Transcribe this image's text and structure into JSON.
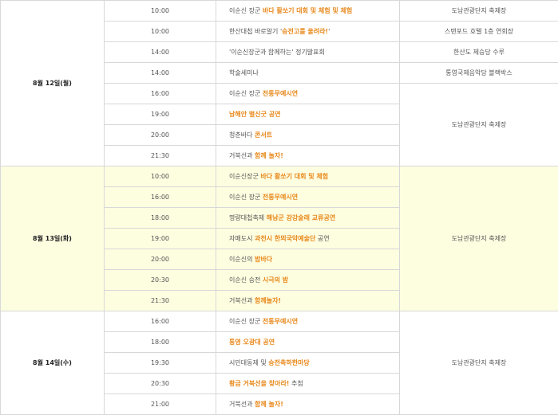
{
  "days": [
    {
      "date": "8월 12일(월)",
      "rows": [
        {
          "time": "10:00",
          "event": [
            {
              "t": "이순신 장군 ",
              "em": false
            },
            {
              "t": "바다 활쏘기 대회 및 체험 및 체험",
              "em": true
            }
          ],
          "venue": "도남관광단지 축제장",
          "span": 1
        },
        {
          "time": "10:00",
          "event": [
            {
              "t": "한산대첩 바로알기 '",
              "em": false
            },
            {
              "t": "승전고를 울려라!",
              "em": true
            },
            {
              "t": "'",
              "em": false
            }
          ],
          "venue": "스탠포드 호텔 1층 연회장",
          "span": 1
        },
        {
          "time": "14:00",
          "event": [
            {
              "t": "'이순신장군과 함께하는' 정기발표회",
              "em": false
            }
          ],
          "venue": "한산도 제승당 수루",
          "span": 1
        },
        {
          "time": "14:00",
          "event": [
            {
              "t": "학술세미나",
              "em": false
            }
          ],
          "venue": "통영국제음악당 블랙박스",
          "span": 1
        },
        {
          "time": "16:00",
          "event": [
            {
              "t": "이순신 장군 ",
              "em": false
            },
            {
              "t": "전통무예시연",
              "em": true
            }
          ],
          "venue": "도남관광단지 축제장",
          "span": 4
        },
        {
          "time": "19:00",
          "event": [
            {
              "t": "남해안 별신굿 공연",
              "em": true
            }
          ]
        },
        {
          "time": "20:00",
          "event": [
            {
              "t": "청춘바다 ",
              "em": false
            },
            {
              "t": "콘서트",
              "em": true
            }
          ]
        },
        {
          "time": "21:30",
          "event": [
            {
              "t": "거북선과 ",
              "em": false
            },
            {
              "t": "함께 놀자!",
              "em": true
            }
          ]
        }
      ]
    },
    {
      "date": "8월 13일(화)",
      "highlight": true,
      "rows": [
        {
          "time": "10:00",
          "event": [
            {
              "t": "이순신장군 ",
              "em": false
            },
            {
              "t": "바다 활쏘기 대회 및 체험",
              "em": true
            }
          ],
          "venue": "도남관광단지 축제장",
          "span": 7
        },
        {
          "time": "16:00",
          "event": [
            {
              "t": "이순신 장군 ",
              "em": false
            },
            {
              "t": "전통무예시연",
              "em": true
            }
          ]
        },
        {
          "time": "18:00",
          "event": [
            {
              "t": "명량대첩축제 ",
              "em": false
            },
            {
              "t": "해남군 강강술래 교류공연",
              "em": true
            }
          ]
        },
        {
          "time": "19:00",
          "event": [
            {
              "t": "자매도시 ",
              "em": false
            },
            {
              "t": "과천시 한뫼국악예술단",
              "em": true
            },
            {
              "t": " 공연",
              "em": false
            }
          ]
        },
        {
          "time": "20:00",
          "event": [
            {
              "t": "이순신의 ",
              "em": false
            },
            {
              "t": "밤바다",
              "em": true
            }
          ]
        },
        {
          "time": "20:30",
          "event": [
            {
              "t": "이순신 승전 ",
              "em": false
            },
            {
              "t": "시극의 밤",
              "em": true
            }
          ]
        },
        {
          "time": "21:30",
          "event": [
            {
              "t": "거북선과 ",
              "em": false
            },
            {
              "t": "함께놀자!",
              "em": true
            }
          ]
        }
      ]
    },
    {
      "date": "8월 14일(수)",
      "rows": [
        {
          "time": "16:00",
          "event": [
            {
              "t": "이순신 장군 ",
              "em": false
            },
            {
              "t": "전통무예시연",
              "em": true
            }
          ],
          "venue": "도남관광단지 축제장",
          "span": 5
        },
        {
          "time": "18:00",
          "event": [
            {
              "t": "통영 오광대 공연",
              "em": true
            }
          ]
        },
        {
          "time": "19:30",
          "event": [
            {
              "t": "시민대동제 및 ",
              "em": false
            },
            {
              "t": "승전축하한마당",
              "em": true
            }
          ]
        },
        {
          "time": "20:30",
          "event": [
            {
              "t": "황금 거북선을 찾아라!",
              "em": true
            },
            {
              "t": " 추첨",
              "em": false
            }
          ]
        },
        {
          "time": "21:00",
          "event": [
            {
              "t": "거북선과 ",
              "em": false
            },
            {
              "t": "함께 놀자!",
              "em": true
            }
          ]
        }
      ]
    }
  ],
  "colors": {
    "accent": "#e8891c",
    "highlight": "#fdfde0",
    "border": "#d8d8d8"
  }
}
